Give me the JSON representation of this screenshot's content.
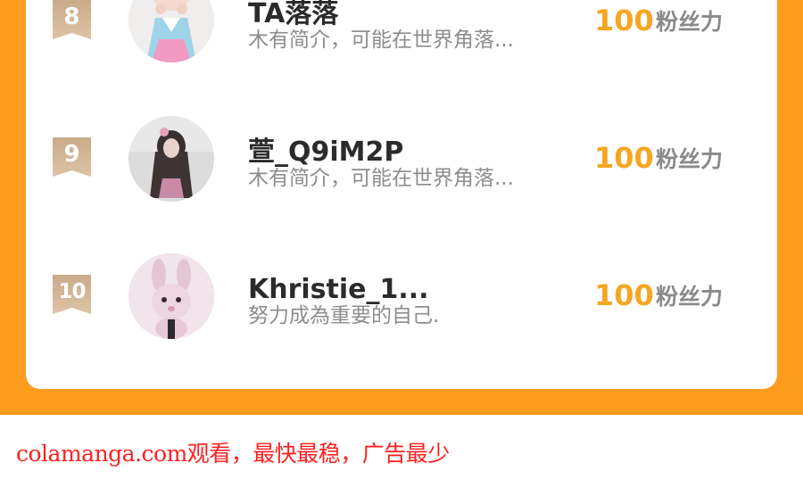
{
  "list": {
    "items": [
      {
        "rank": "8",
        "name": "TA落落",
        "bio": "木有简介，可能在世界角落...",
        "score": "100",
        "score_label": "粉丝力"
      },
      {
        "rank": "9",
        "name": "萱_Q9iM2P",
        "bio": "木有简介，可能在世界角落...",
        "score": "100",
        "score_label": "粉丝力"
      },
      {
        "rank": "10",
        "name": "Khristie_1...",
        "bio": "努力成為重要的自己.",
        "score": "100",
        "score_label": "粉丝力"
      }
    ]
  },
  "watermark": {
    "text": "colamanga.com观看，最快最稳，广告最少"
  },
  "colors": {
    "background_band": "#fe9c1e",
    "score": "#f5a623",
    "rank_badge": "#d4b796",
    "watermark": "#ff2020"
  }
}
